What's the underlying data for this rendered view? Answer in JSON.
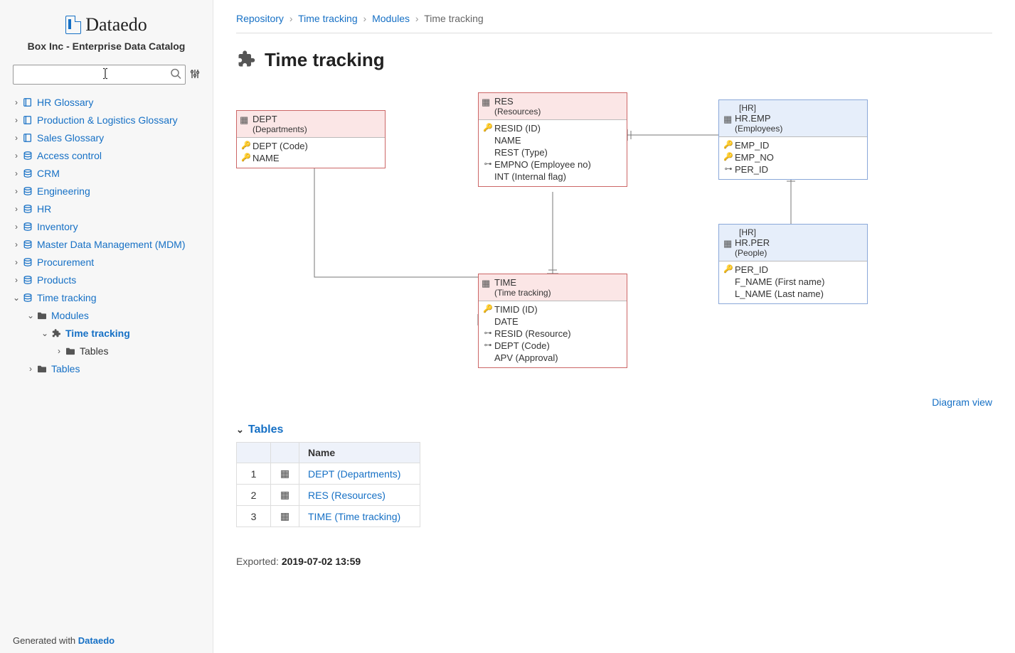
{
  "app": {
    "logo_text": "Dataedo",
    "subtitle": "Box Inc - Enterprise Data Catalog",
    "footer_prefix": "Generated with ",
    "footer_brand": "Dataedo"
  },
  "search": {
    "value": "",
    "placeholder": ""
  },
  "nav": [
    {
      "icon": "book",
      "label": "HR Glossary"
    },
    {
      "icon": "book",
      "label": "Production & Logistics Glossary"
    },
    {
      "icon": "book",
      "label": "Sales Glossary"
    },
    {
      "icon": "db",
      "label": "Access control"
    },
    {
      "icon": "db",
      "label": "CRM"
    },
    {
      "icon": "db",
      "label": "Engineering"
    },
    {
      "icon": "db",
      "label": "HR"
    },
    {
      "icon": "db",
      "label": "Inventory"
    },
    {
      "icon": "db",
      "label": "Master Data Management (MDM)"
    },
    {
      "icon": "db",
      "label": "Procurement"
    },
    {
      "icon": "db",
      "label": "Products"
    }
  ],
  "nav_tt": {
    "root": "Time tracking",
    "modules": "Modules",
    "module": "Time tracking",
    "tables": "Tables",
    "root_tables": "Tables"
  },
  "breadcrumb": {
    "a": "Repository",
    "b": "Time tracking",
    "c": "Modules",
    "d": "Time tracking"
  },
  "title": "Time tracking",
  "diagram_link": "Diagram view",
  "entities": {
    "dept": {
      "name": "DEPT",
      "desc": "(Departments)",
      "cols": [
        {
          "k": "pk",
          "t": "DEPT (Code)"
        },
        {
          "k": "pk",
          "t": "NAME"
        }
      ]
    },
    "res": {
      "name": "RES",
      "desc": "(Resources)",
      "cols": [
        {
          "k": "pk",
          "t": "RESID (ID)"
        },
        {
          "k": "",
          "t": "NAME"
        },
        {
          "k": "",
          "t": "REST (Type)"
        },
        {
          "k": "fk",
          "t": "EMPNO (Employee no)"
        },
        {
          "k": "",
          "t": "INT (Internal flag)"
        }
      ]
    },
    "time": {
      "name": "TIME",
      "desc": "(Time tracking)",
      "cols": [
        {
          "k": "pk",
          "t": "TIMID (ID)"
        },
        {
          "k": "",
          "t": "DATE"
        },
        {
          "k": "fk",
          "t": "RESID (Resource)"
        },
        {
          "k": "fk",
          "t": "DEPT (Code)"
        },
        {
          "k": "",
          "t": "APV (Approval)"
        }
      ]
    },
    "emp": {
      "schema": "[HR]",
      "name": "HR.EMP",
      "desc": "(Employees)",
      "cols": [
        {
          "k": "pk",
          "t": "EMP_ID"
        },
        {
          "k": "pk",
          "t": "EMP_NO"
        },
        {
          "k": "fk",
          "t": "PER_ID"
        }
      ]
    },
    "per": {
      "schema": "[HR]",
      "name": "HR.PER",
      "desc": "(People)",
      "cols": [
        {
          "k": "pk",
          "t": "PER_ID"
        },
        {
          "k": "",
          "t": "F_NAME (First name)"
        },
        {
          "k": "",
          "t": "L_NAME (Last name)"
        }
      ]
    }
  },
  "tables_section": "Tables",
  "tables_header": "Name",
  "tables": [
    {
      "n": "1",
      "name": "DEPT (Departments)"
    },
    {
      "n": "2",
      "name": "RES (Resources)"
    },
    {
      "n": "3",
      "name": "TIME (Time tracking)"
    }
  ],
  "exported_label": "Exported: ",
  "exported_ts": "2019-07-02 13:59"
}
